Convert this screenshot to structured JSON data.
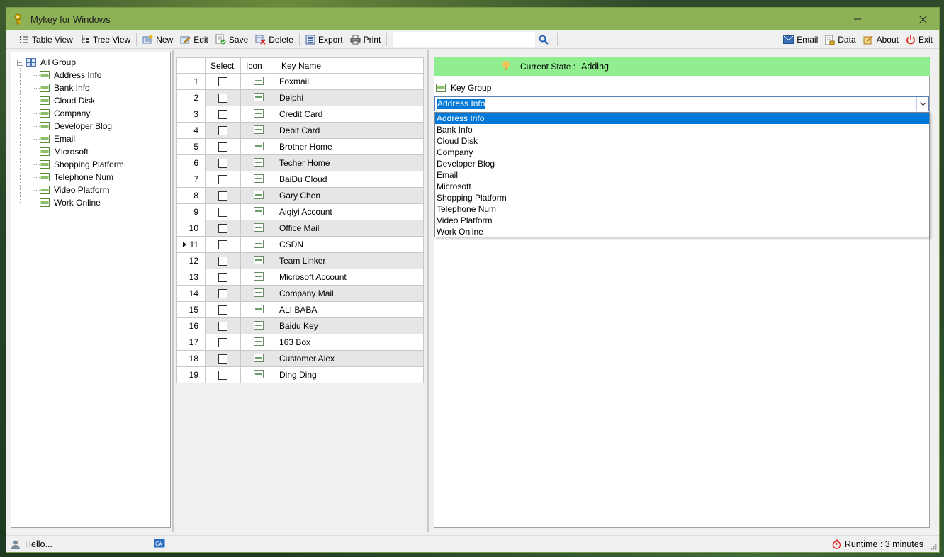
{
  "window": {
    "title": "Mykey for Windows"
  },
  "toolbar": {
    "table_view": "Table View",
    "tree_view": "Tree View",
    "new": "New",
    "edit": "Edit",
    "save": "Save",
    "delete": "Delete",
    "export": "Export",
    "print": "Print",
    "search_value": "",
    "email": "Email",
    "data": "Data",
    "about": "About",
    "exit": "Exit"
  },
  "tree": {
    "root": "All Group",
    "items": [
      "Address Info",
      "Bank Info",
      "Cloud Disk",
      "Company",
      "Developer Blog",
      "Email",
      "Microsoft",
      "Shopping Platform",
      "Telephone Num",
      "Video Platform",
      "Work Online"
    ]
  },
  "grid": {
    "columns": [
      "Select",
      "Icon",
      "Key Name"
    ],
    "current_row": 11,
    "rows": [
      {
        "num": "1",
        "name": "Foxmail"
      },
      {
        "num": "2",
        "name": "Delphi"
      },
      {
        "num": "3",
        "name": "Credit Card"
      },
      {
        "num": "4",
        "name": "Debit Card"
      },
      {
        "num": "5",
        "name": "Brother Home"
      },
      {
        "num": "6",
        "name": "Techer Home"
      },
      {
        "num": "7",
        "name": "BaiDu Cloud"
      },
      {
        "num": "8",
        "name": "Gary Chen"
      },
      {
        "num": "9",
        "name": "Aiqiyi Account"
      },
      {
        "num": "10",
        "name": "Office Mail"
      },
      {
        "num": "11",
        "name": "CSDN"
      },
      {
        "num": "12",
        "name": "Team Linker"
      },
      {
        "num": "13",
        "name": "Microsoft Account"
      },
      {
        "num": "14",
        "name": "Company Mail"
      },
      {
        "num": "15",
        "name": "ALI BABA"
      },
      {
        "num": "16",
        "name": "Baidu Key"
      },
      {
        "num": "17",
        "name": "163 Box"
      },
      {
        "num": "18",
        "name": "Customer Alex"
      },
      {
        "num": "19",
        "name": "Ding Ding"
      }
    ]
  },
  "detail": {
    "state_label": "Current State :",
    "state_value": "Adding",
    "key_group_label": "Key Group",
    "key_group_value": "Address Info",
    "options": [
      "Address Info",
      "Bank Info",
      "Cloud Disk",
      "Company",
      "Developer Blog",
      "Email",
      "Microsoft",
      "Shopping Platform",
      "Telephone Num",
      "Video Platform",
      "Work Online"
    ]
  },
  "status": {
    "message": "Hello...",
    "runtime": "Runtime : 3 minutes"
  },
  "colors": {
    "titlebar": "#8db255",
    "state_bar": "#90ee90",
    "selection": "#0078d7",
    "alt_row": "#e6e6e6"
  }
}
